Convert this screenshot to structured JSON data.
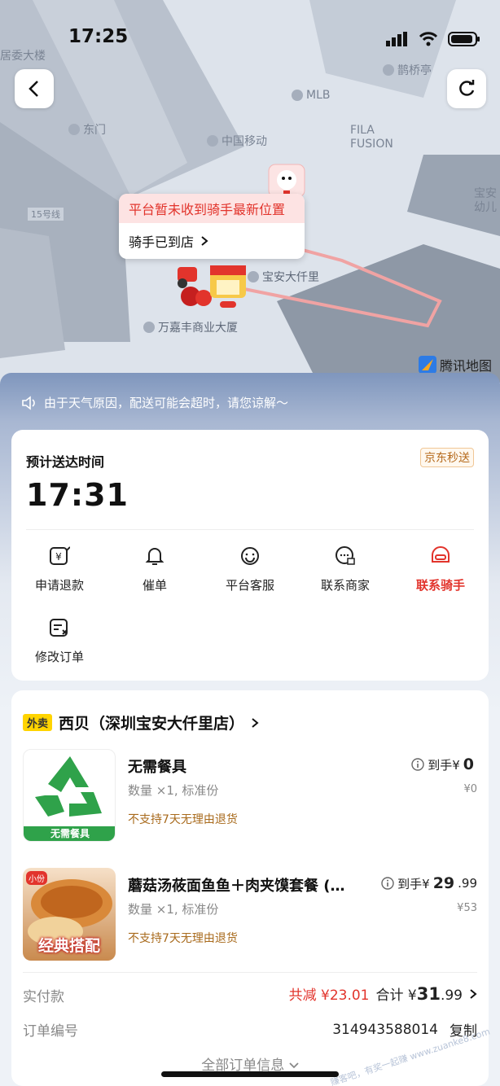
{
  "status_bar": {
    "time": "17:25"
  },
  "map": {
    "pois": [
      "居委大楼",
      "鹊桥亭",
      "MLB",
      "东门",
      "中国移动",
      "FILA",
      "FUSION",
      "宝安",
      "幼儿",
      "15号线",
      "宝安大仟里",
      "万嘉丰商业大厦"
    ],
    "tooltip": {
      "warning": "平台暂未收到骑手最新位置",
      "status": "骑手已到店"
    },
    "brand": "腾讯地图"
  },
  "notice": "由于天气原因，配送可能会超时，请您谅解～",
  "eta": {
    "title": "预计送达时间",
    "time": "17:31",
    "service": "京东秒送"
  },
  "actions": [
    {
      "label": "申请退款",
      "icon": "refund-icon",
      "color": "#222"
    },
    {
      "label": "催单",
      "icon": "bell-icon",
      "color": "#222"
    },
    {
      "label": "平台客服",
      "icon": "smile-service-icon",
      "color": "#222"
    },
    {
      "label": "联系商家",
      "icon": "chat-store-icon",
      "color": "#222"
    },
    {
      "label": "联系骑手",
      "icon": "rider-helmet-icon",
      "color": "#e2342c"
    },
    {
      "label": "修改订单",
      "icon": "edit-order-icon",
      "color": "#222"
    }
  ],
  "order": {
    "tag": "外卖",
    "store": "西贝（深圳宝安大仟里店）",
    "items": [
      {
        "name": "无需餐具",
        "spec": "数量 ×1, 标准份",
        "note": "不支持7天无理由退货",
        "price_prefix": "到手¥",
        "price_int": "0",
        "price_dec": "",
        "orig": "¥0",
        "thumb_label": "无需餐具"
      },
      {
        "name": "蘑菇汤莜面鱼鱼＋肉夹馍套餐 (…",
        "spec": "数量 ×1, 标准份",
        "note": "不支持7天无理由退货",
        "price_prefix": "到手¥",
        "price_int": "29",
        "price_dec": ".99",
        "orig": "¥53",
        "thumb_label": "经典搭配",
        "thumb_badge": "小份"
      }
    ],
    "paid_label": "实付款",
    "discount": "共减 ¥23.01",
    "total_label": "合计 ¥",
    "total_int": "31",
    "total_dec": ".99",
    "order_no_label": "订单编号",
    "order_no": "314943588014",
    "copy": "复制",
    "all_info": "全部订单信息"
  },
  "watermark": "赚客吧，有奖一起赚 www.zuanke8.com",
  "colors": {
    "accent_red": "#e2342c",
    "jd_orange": "#b56a1c",
    "recycle_green": "#2fa24a"
  }
}
